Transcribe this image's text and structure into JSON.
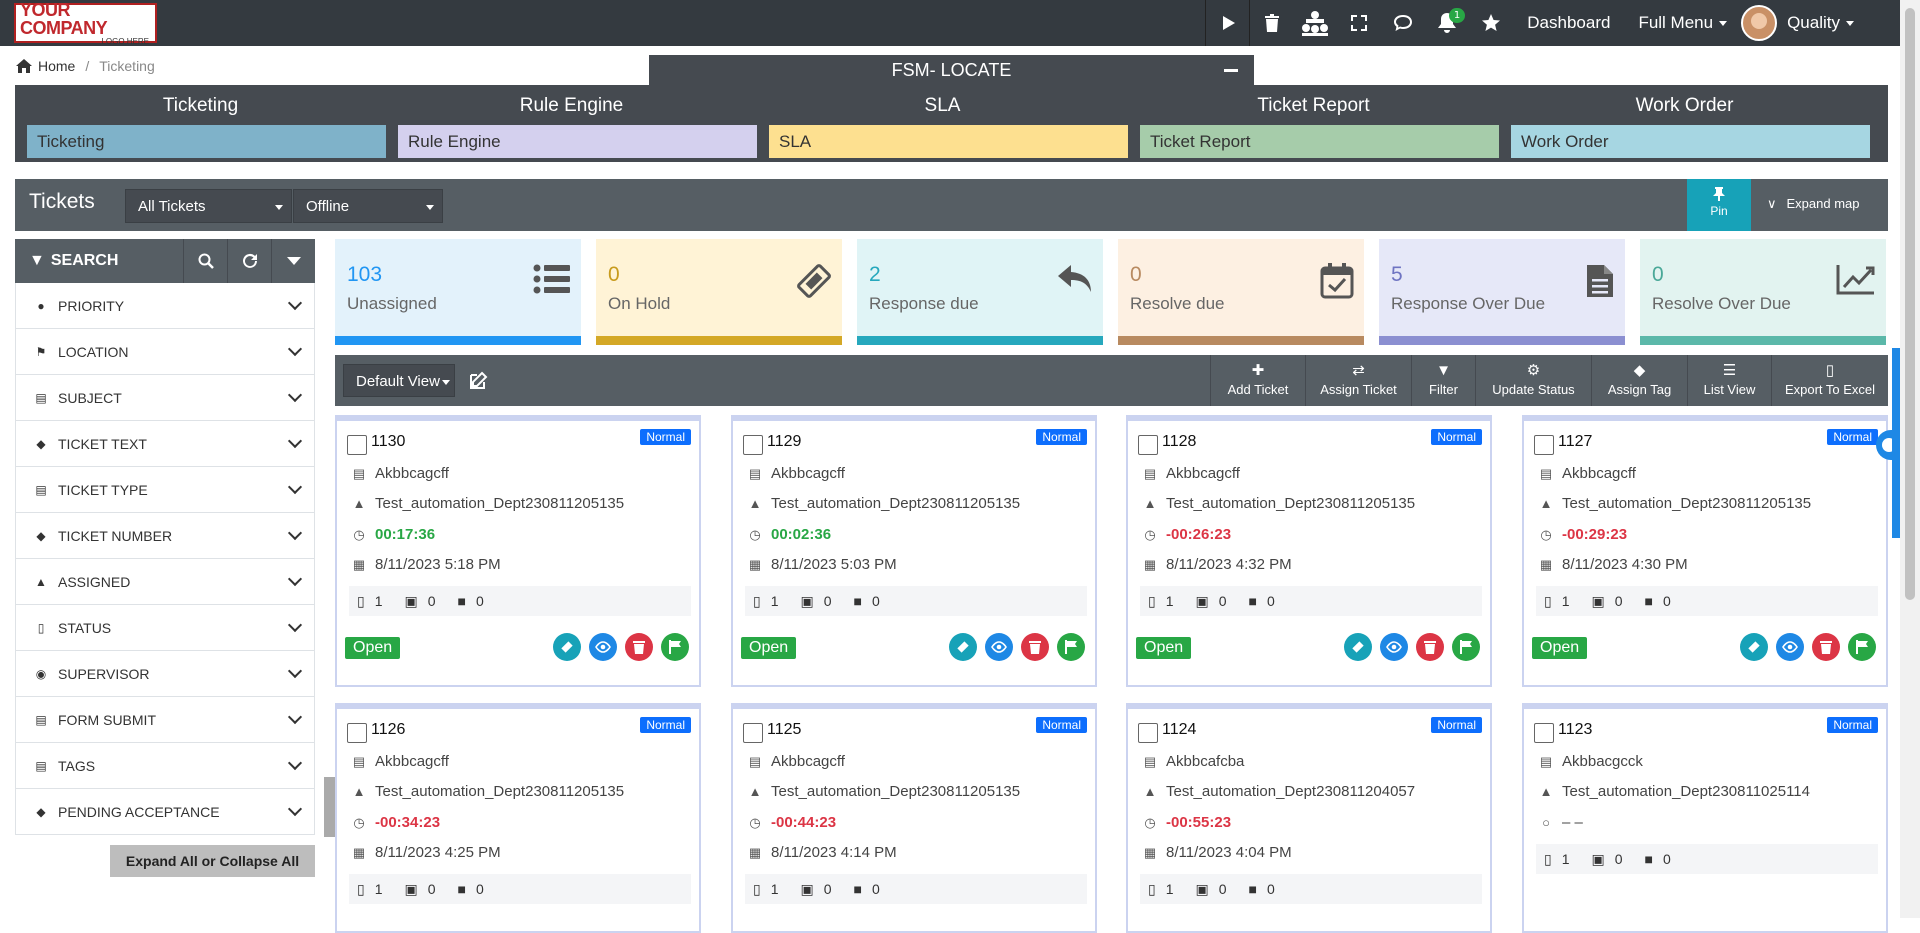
{
  "header": {
    "logo_line1": "YOUR COMPANY",
    "logo_line2": "LOGO HERE",
    "notif_count": "1",
    "dashboard": "Dashboard",
    "full_menu": "Full Menu",
    "user": "Quality",
    "icons": [
      "play-icon",
      "trash-icon",
      "sitemap-icon",
      "expand-icon",
      "chat-icon",
      "bell-icon",
      "star-icon"
    ]
  },
  "breadcrumb": {
    "home": "Home",
    "current": "Ticketing"
  },
  "fsm_title": "FSM- LOCATE",
  "modules": [
    {
      "title": "Ticketing",
      "button": "Ticketing",
      "color": "#7fb2c9"
    },
    {
      "title": "Rule Engine",
      "button": "Rule Engine",
      "color": "#d4d0ee"
    },
    {
      "title": "SLA",
      "button": "SLA",
      "color": "#fde090"
    },
    {
      "title": "Ticket Report",
      "button": "Ticket Report",
      "color": "#a6ccaa"
    },
    {
      "title": "Work Order",
      "button": "Work Order",
      "color": "#a6d6e2"
    }
  ],
  "tickets_bar": {
    "title": "Tickets",
    "filter1": "All Tickets",
    "filter2": "Offline",
    "pin": "Pin",
    "expand_map": "Expand map"
  },
  "search": {
    "title": "SEARCH",
    "items": [
      "PRIORITY",
      "LOCATION",
      "SUBJECT",
      "TICKET TEXT",
      "TICKET TYPE",
      "TICKET NUMBER",
      "ASSIGNED",
      "STATUS",
      "SUPERVISOR",
      "FORM SUBMIT",
      "TAGS",
      "PENDING ACCEPTANCE"
    ],
    "expand_all": "Expand All or Collapse All"
  },
  "stats": [
    {
      "value": "103",
      "label": "Unassigned",
      "bg": "#e3f2fb",
      "bar": "#2196f3",
      "color": "#2196f3",
      "icon": "list-icon"
    },
    {
      "value": "0",
      "label": "On Hold",
      "bg": "#fff3d6",
      "bar": "#d4a826",
      "color": "#c89b1d",
      "icon": "ticket-icon"
    },
    {
      "value": "2",
      "label": "Response due",
      "bg": "#e0f4f6",
      "bar": "#26a8bd",
      "color": "#26a8bd",
      "icon": "reply-icon"
    },
    {
      "value": "0",
      "label": "Resolve due",
      "bg": "#fdf0e2",
      "bar": "#b88a60",
      "color": "#b88a60",
      "icon": "calendar-check-icon"
    },
    {
      "value": "5",
      "label": "Response Over Due",
      "bg": "#e6e8f8",
      "bar": "#8b8fd1",
      "color": "#6f74c2",
      "icon": "file-icon"
    },
    {
      "value": "0",
      "label": "Resolve Over Due",
      "bg": "#e2f3f0",
      "bar": "#5bb8a9",
      "color": "#4aa898",
      "icon": "chart-line-icon"
    }
  ],
  "toolbar": {
    "default_view": "Default View",
    "buttons": [
      "Add Ticket",
      "Assign Ticket",
      "Filter",
      "Update Status",
      "Assign Tag",
      "List View",
      "Export To Excel"
    ]
  },
  "tickets": [
    {
      "id": "1130",
      "priority": "Normal",
      "subject": "Akbbcagcff",
      "dept": "Test_automation_Dept230811205135",
      "time": "00:17:36",
      "time_status": "ok",
      "date": "8/11/2023 5:18 PM",
      "docs": "1",
      "images": "0",
      "videos": "0",
      "status": "Open"
    },
    {
      "id": "1129",
      "priority": "Normal",
      "subject": "Akbbcagcff",
      "dept": "Test_automation_Dept230811205135",
      "time": "00:02:36",
      "time_status": "ok",
      "date": "8/11/2023 5:03 PM",
      "docs": "1",
      "images": "0",
      "videos": "0",
      "status": "Open"
    },
    {
      "id": "1128",
      "priority": "Normal",
      "subject": "Akbbcagcff",
      "dept": "Test_automation_Dept230811205135",
      "time": "-00:26:23",
      "time_status": "late",
      "date": "8/11/2023 4:32 PM",
      "docs": "1",
      "images": "0",
      "videos": "0",
      "status": "Open"
    },
    {
      "id": "1127",
      "priority": "Normal",
      "subject": "Akbbcagcff",
      "dept": "Test_automation_Dept230811205135",
      "time": "-00:29:23",
      "time_status": "late",
      "date": "8/11/2023 4:30 PM",
      "docs": "1",
      "images": "0",
      "videos": "0",
      "status": "Open"
    },
    {
      "id": "1126",
      "priority": "Normal",
      "subject": "Akbbcagcff",
      "dept": "Test_automation_Dept230811205135",
      "time": "-00:34:23",
      "time_status": "late",
      "date": "8/11/2023 4:25 PM",
      "docs": "1",
      "images": "0",
      "videos": "0"
    },
    {
      "id": "1125",
      "priority": "Normal",
      "subject": "Akbbcagcff",
      "dept": "Test_automation_Dept230811205135",
      "time": "-00:44:23",
      "time_status": "late",
      "date": "8/11/2023 4:14 PM",
      "docs": "1",
      "images": "0",
      "videos": "0"
    },
    {
      "id": "1124",
      "priority": "Normal",
      "subject": "Akbbcafcba",
      "dept": "Test_automation_Dept230811204057",
      "time": "-00:55:23",
      "time_status": "late",
      "date": "8/11/2023 4:04 PM",
      "docs": "1",
      "images": "0",
      "videos": "0"
    },
    {
      "id": "1123",
      "priority": "Normal",
      "subject": "Akbbacgcck",
      "dept": "Test_automation_Dept230811025114",
      "assignee": "– –",
      "docs": "1",
      "images": "0",
      "videos": "0"
    }
  ]
}
